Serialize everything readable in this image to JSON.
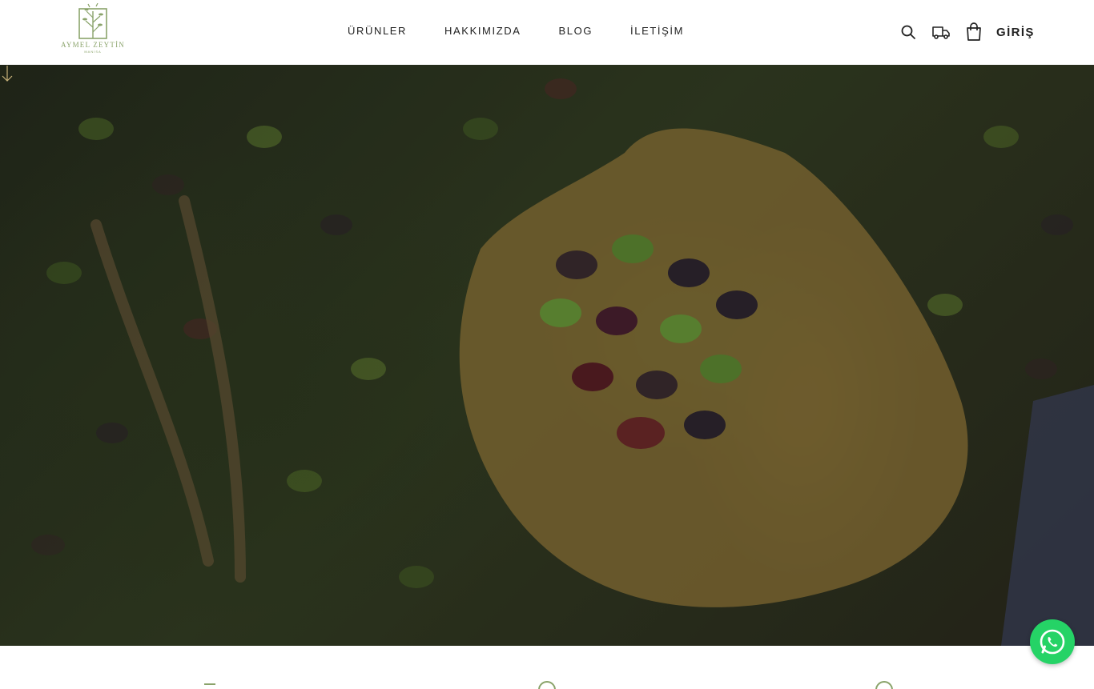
{
  "brand": {
    "name": "AYMEL ZEYTİN",
    "tagline": "MANİSA"
  },
  "nav": {
    "items": [
      "ÜRÜNLER",
      "HAKKIMIZDA",
      "BLOG",
      "İLETİŞİM"
    ]
  },
  "header": {
    "login_label": "GİRİŞ"
  },
  "icons": {
    "search": "search-icon",
    "shipping": "truck-icon",
    "cart": "shopping-bag-icon",
    "scroll": "arrow-down-icon",
    "chat": "whatsapp-icon"
  },
  "colors": {
    "brand": "#8aa36a",
    "text": "#222222",
    "whatsapp": "#25d366"
  }
}
